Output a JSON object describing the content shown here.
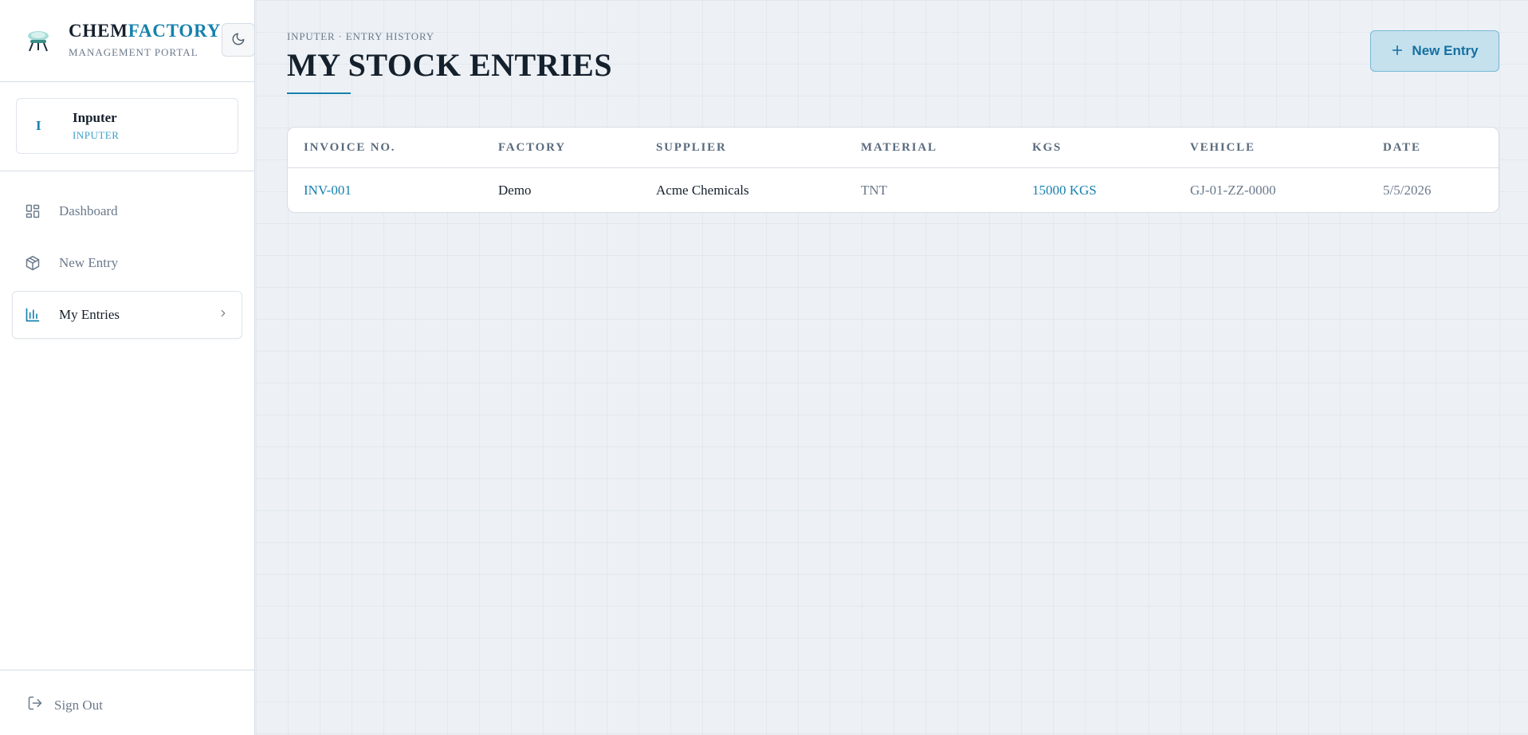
{
  "brand": {
    "name_part1": "CHEM",
    "name_part2": "FACTORY",
    "subtitle": "MANAGEMENT PORTAL"
  },
  "theme_toggle": {
    "icon": "moon-icon"
  },
  "user": {
    "initial": "I",
    "name": "Inputer",
    "role": "INPUTER"
  },
  "sidebar": {
    "items": [
      {
        "label": "Dashboard",
        "icon": "grid-icon",
        "active": false
      },
      {
        "label": "New Entry",
        "icon": "box-icon",
        "active": false
      },
      {
        "label": "My Entries",
        "icon": "bar-chart-icon",
        "active": true
      }
    ],
    "signout_label": "Sign Out"
  },
  "header": {
    "breadcrumb": "INPUTER · ENTRY HISTORY",
    "title": "MY STOCK ENTRIES",
    "new_entry_label": "New Entry"
  },
  "table": {
    "columns": [
      "INVOICE NO.",
      "FACTORY",
      "SUPPLIER",
      "MATERIAL",
      "KGS",
      "VEHICLE",
      "DATE"
    ],
    "rows": [
      {
        "invoice": "INV-001",
        "factory": "Demo",
        "supplier": "Acme Chemicals",
        "material": "TNT",
        "kgs": "15000 KGS",
        "vehicle": "GJ-01-ZZ-0000",
        "date": "5/5/2026"
      }
    ]
  },
  "colors": {
    "accent": "#1781ad",
    "background": "#edf1f5",
    "text": "#15202d",
    "muted": "#6b7a8c"
  }
}
